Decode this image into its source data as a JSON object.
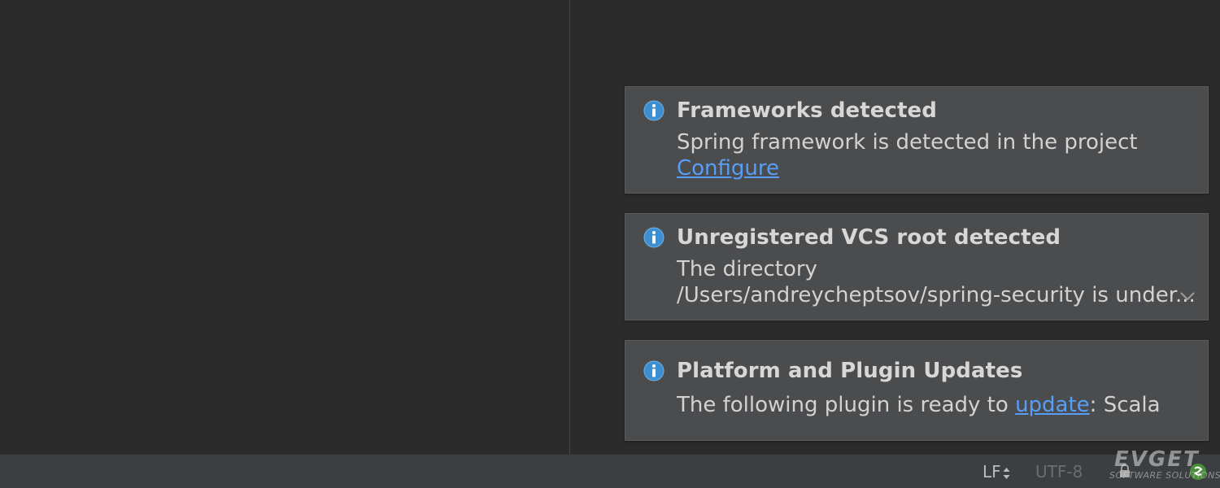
{
  "notifications": [
    {
      "title": "Frameworks detected",
      "line1": "Spring framework is detected in the project",
      "link": "Configure"
    },
    {
      "title": "Unregistered VCS root detected",
      "line1": "The directory",
      "line2": "/Users/andreycheptsov/spring-security is under..."
    },
    {
      "title": "Platform and Plugin Updates",
      "prefix": "The following plugin is ready to ",
      "link": "update",
      "suffix": ": Scala"
    }
  ],
  "statusbar": {
    "line_separator": "LF",
    "encoding": "UTF-8"
  },
  "watermark": {
    "brand": "EVGET",
    "tagline": "SOFTWARE SOLUTIONS"
  },
  "colors": {
    "background": "#2b2b2b",
    "balloon": "#4b4c4e",
    "link": "#589df6",
    "info_icon": "#3d8fd1",
    "statusbar": "#3c3f41"
  },
  "icons": {
    "notification": "info-icon",
    "expand": "chevron-down-icon",
    "lock": "lock-icon",
    "status": "status-icon"
  }
}
